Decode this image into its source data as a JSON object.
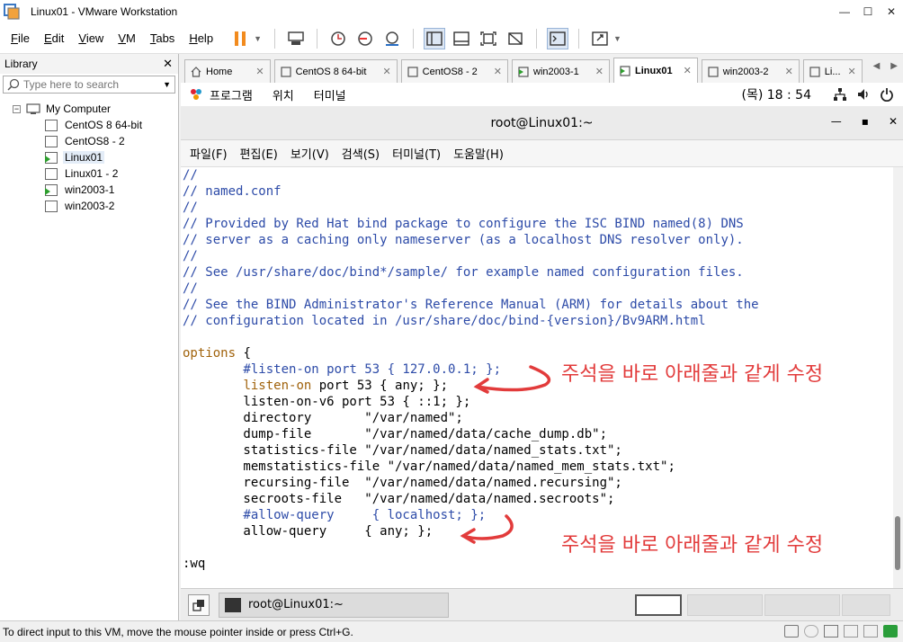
{
  "window": {
    "title": "Linux01 - VMware Workstation"
  },
  "menu": {
    "items": [
      {
        "label": "File",
        "u": "F",
        "rest": "ile"
      },
      {
        "label": "Edit",
        "u": "E",
        "rest": "dit"
      },
      {
        "label": "View",
        "u": "V",
        "rest": "iew"
      },
      {
        "label": "VM",
        "u": "V",
        "rest": "M"
      },
      {
        "label": "Tabs",
        "u": "T",
        "rest": "abs"
      },
      {
        "label": "Help",
        "u": "H",
        "rest": "elp"
      }
    ]
  },
  "library": {
    "title": "Library",
    "search_placeholder": "Type here to search",
    "root": "My Computer",
    "vms": [
      {
        "name": "CentOS 8 64-bit",
        "running": false
      },
      {
        "name": "CentOS8 - 2",
        "running": false
      },
      {
        "name": "Linux01",
        "running": true
      },
      {
        "name": "Linux01 - 2",
        "running": false
      },
      {
        "name": "win2003-1",
        "running": true
      },
      {
        "name": "win2003-2",
        "running": false
      }
    ]
  },
  "tabs": [
    {
      "label": "Home"
    },
    {
      "label": "CentOS 8 64-bit"
    },
    {
      "label": "CentOS8 - 2"
    },
    {
      "label": "win2003-1"
    },
    {
      "label": "Linux01"
    },
    {
      "label": "win2003-2"
    },
    {
      "label": "Li..."
    }
  ],
  "gnome": {
    "apps": "프로그램",
    "places": "위치",
    "terminal": "터미널",
    "clock": "(목) 18 : 54"
  },
  "terminal": {
    "title": "root@Linux01:~",
    "menu": [
      "파일(F)",
      "편집(E)",
      "보기(V)",
      "검색(S)",
      "터미널(T)",
      "도움말(H)"
    ],
    "lines": [
      {
        "t": "//",
        "c": "comment"
      },
      {
        "t": "// named.conf",
        "c": "comment"
      },
      {
        "t": "//",
        "c": "comment"
      },
      {
        "t": "// Provided by Red Hat bind package to configure the ISC BIND named(8) DNS",
        "c": "comment"
      },
      {
        "t": "// server as a caching only nameserver (as a localhost DNS resolver only).",
        "c": "comment"
      },
      {
        "t": "//",
        "c": "comment"
      },
      {
        "t": "// See /usr/share/doc/bind*/sample/ for example named configuration files.",
        "c": "comment"
      },
      {
        "t": "//",
        "c": "comment"
      },
      {
        "t": "// See the BIND Administrator's Reference Manual (ARM) for details about the",
        "c": "comment"
      },
      {
        "t": "// configuration located in /usr/share/doc/bind-{version}/Bv9ARM.html",
        "c": "comment"
      },
      {
        "t": "",
        "c": "plain"
      },
      {
        "t": "options {",
        "c": "options"
      },
      {
        "t": "        #listen-on port 53 { 127.0.0.1; };",
        "c": "comment"
      },
      {
        "t": "        listen-on port 53 { any; };",
        "c": "listen"
      },
      {
        "t": "        listen-on-v6 port 53 { ::1; };",
        "c": "plain"
      },
      {
        "t": "        directory       \"/var/named\";",
        "c": "plain"
      },
      {
        "t": "        dump-file       \"/var/named/data/cache_dump.db\";",
        "c": "plain"
      },
      {
        "t": "        statistics-file \"/var/named/data/named_stats.txt\";",
        "c": "plain"
      },
      {
        "t": "        memstatistics-file \"/var/named/data/named_mem_stats.txt\";",
        "c": "plain"
      },
      {
        "t": "        recursing-file  \"/var/named/data/named.recursing\";",
        "c": "plain"
      },
      {
        "t": "        secroots-file   \"/var/named/data/named.secroots\";",
        "c": "plain"
      },
      {
        "t": "        #allow-query     { localhost; };",
        "c": "comment"
      },
      {
        "t": "        allow-query     { any; };",
        "c": "plain"
      },
      {
        "t": "",
        "c": "plain"
      },
      {
        "t": ":wq",
        "c": "plain"
      }
    ],
    "annotation_1": "주석을 바로 아래줄과 같게 수정",
    "annotation_2": "주석을 바로 아래줄과 같게 수정"
  },
  "taskbar": {
    "item": "root@Linux01:~"
  },
  "status": {
    "text": "To direct input to this VM, move the mouse pointer inside or press Ctrl+G."
  }
}
